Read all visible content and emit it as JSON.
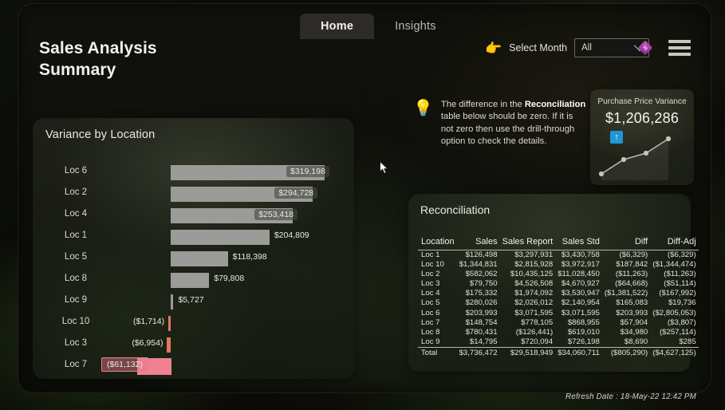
{
  "tabs": [
    {
      "label": "Home",
      "active": true
    },
    {
      "label": "Insights",
      "active": false
    }
  ],
  "header": {
    "title": "Sales Analysis Summary",
    "title_line1": "Sales Analysis",
    "title_line2": "Summary"
  },
  "month_picker": {
    "hand_icon": "point-right-hand-icon",
    "hand_glyph": "👉",
    "label": "Select Month",
    "selected": "All",
    "options": [
      "All"
    ]
  },
  "top_icons": {
    "powerapps": "powerapps-diamond-icon",
    "menu": "hamburger-menu-icon"
  },
  "variance_card": {
    "title": "Variance by Location"
  },
  "tip": {
    "icon": "lightbulb-icon",
    "icon_glyph": "💡",
    "text_part1": "The difference in the ",
    "bold": "Reconciliation",
    "text_part2": " table below should be zero. If it is not zero then use the drill-through option to check the details."
  },
  "kpi": {
    "title": "Purchase Price Variance",
    "value": "$1,206,286",
    "trend_icon": "arrow-up-icon",
    "trend_glyph": "↑",
    "trend_color": "#2196d6"
  },
  "reconciliation": {
    "title": "Reconciliation",
    "columns": [
      "Location",
      "Sales",
      "Sales Report",
      "Sales Std",
      "Diff",
      "Diff-Adj"
    ],
    "rows": [
      [
        "Loc 1",
        "$126,498",
        "$3,297,931",
        "$3,430,758",
        "($6,329)",
        "($6,329)"
      ],
      [
        "Loc 10",
        "$1,344,831",
        "$2,815,928",
        "$3,972,917",
        "$187,842",
        "($1,344,474)"
      ],
      [
        "Loc 2",
        "$582,062",
        "$10,435,125",
        "$11,028,450",
        "($11,263)",
        "($11,263)"
      ],
      [
        "Loc 3",
        "$79,750",
        "$4,526,508",
        "$4,670,927",
        "($64,668)",
        "($51,114)"
      ],
      [
        "Loc 4",
        "$175,332",
        "$1,974,092",
        "$3,530,947",
        "($1,381,522)",
        "($167,992)"
      ],
      [
        "Loc 5",
        "$280,026",
        "$2,026,012",
        "$2,140,954",
        "$165,083",
        "$19,736"
      ],
      [
        "Loc 6",
        "$203,993",
        "$3,071,595",
        "$3,071,595",
        "$203,993",
        "($2,805,053)"
      ],
      [
        "Loc 7",
        "$148,754",
        "$778,105",
        "$868,955",
        "$57,904",
        "($3,807)"
      ],
      [
        "Loc 8",
        "$780,431",
        "($126,441)",
        "$619,010",
        "$34,980",
        "($257,114)"
      ],
      [
        "Loc 9",
        "$14,795",
        "$720,094",
        "$726,198",
        "$8,690",
        "$285"
      ]
    ],
    "total_row": [
      "Total",
      "$3,736,472",
      "$29,518,949",
      "$34,060,711",
      "($805,290)",
      "($4,627,125)"
    ]
  },
  "footer": {
    "refresh_date": "Refresh Date :  18-May-22 12:42 PM"
  },
  "chart_data": {
    "type": "bar",
    "title": "Variance by Location",
    "orientation": "horizontal",
    "xlabel": "",
    "ylabel": "",
    "categories": [
      "Loc 6",
      "Loc 2",
      "Loc 4",
      "Loc 1",
      "Loc 5",
      "Loc 8",
      "Loc 9",
      "Loc 10",
      "Loc 3",
      "Loc 7"
    ],
    "values": [
      319198,
      294728,
      253418,
      204809,
      118398,
      79808,
      5727,
      -1714,
      -6954,
      -61132
    ],
    "value_labels": [
      "$319,198",
      "$294,728",
      "$253,418",
      "$204,809",
      "$118,398",
      "$79,808",
      "$5,727",
      "($1,714)",
      "($6,954)",
      "($61,132)"
    ],
    "selected_category": "Loc 7",
    "positive_color": "#9b9b98",
    "negative_color": "#ef8190",
    "xlim": [
      -70000,
      340000
    ],
    "grid": false,
    "legend": false
  },
  "kpi_sparkline": {
    "type": "line",
    "points": [
      0,
      22,
      44,
      58,
      80
    ],
    "color": "#b9b7b1",
    "markers": true
  }
}
